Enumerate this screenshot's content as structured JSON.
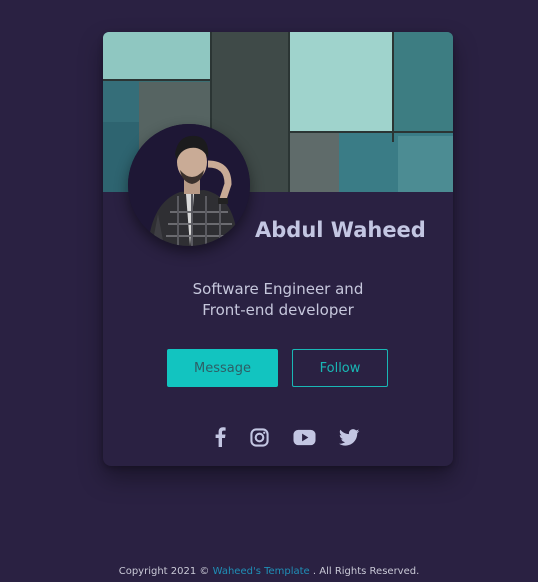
{
  "profile": {
    "name": "Abdul Waheed",
    "bio_line1": "Software Engineer and",
    "bio_line2": "Front-end developer"
  },
  "buttons": {
    "message": "Message",
    "follow": "Follow"
  },
  "socials": [
    {
      "icon": "facebook-icon"
    },
    {
      "icon": "instagram-icon"
    },
    {
      "icon": "youtube-icon"
    },
    {
      "icon": "twitter-icon"
    }
  ],
  "footer": {
    "prefix": "Copyright 2021 © ",
    "link": "Waheed's Template",
    "suffix": " . All Rights Reserved."
  },
  "colors": {
    "background": "#2a2142",
    "accent": "#12c4c0",
    "name": "#c3c6e2",
    "footer_link": "#1f8fb7"
  }
}
